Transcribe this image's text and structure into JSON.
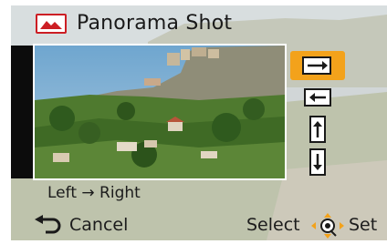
{
  "header": {
    "title": "Panorama Shot",
    "icon": "panorama-icon"
  },
  "direction": {
    "current": "Left → Right",
    "options": [
      {
        "name": "left-to-right",
        "icon": "arrow-right-icon",
        "selected": true
      },
      {
        "name": "right-to-left",
        "icon": "arrow-left-icon",
        "selected": false
      },
      {
        "name": "bottom-to-top",
        "icon": "arrow-up-icon",
        "selected": false
      },
      {
        "name": "top-to-bottom",
        "icon": "arrow-down-icon",
        "selected": false
      }
    ]
  },
  "footer": {
    "cancel_label": "Cancel",
    "select_label": "Select",
    "set_label": "Set"
  },
  "colors": {
    "accent": "#f3a21b",
    "title_icon_red": "#cc1e24"
  }
}
